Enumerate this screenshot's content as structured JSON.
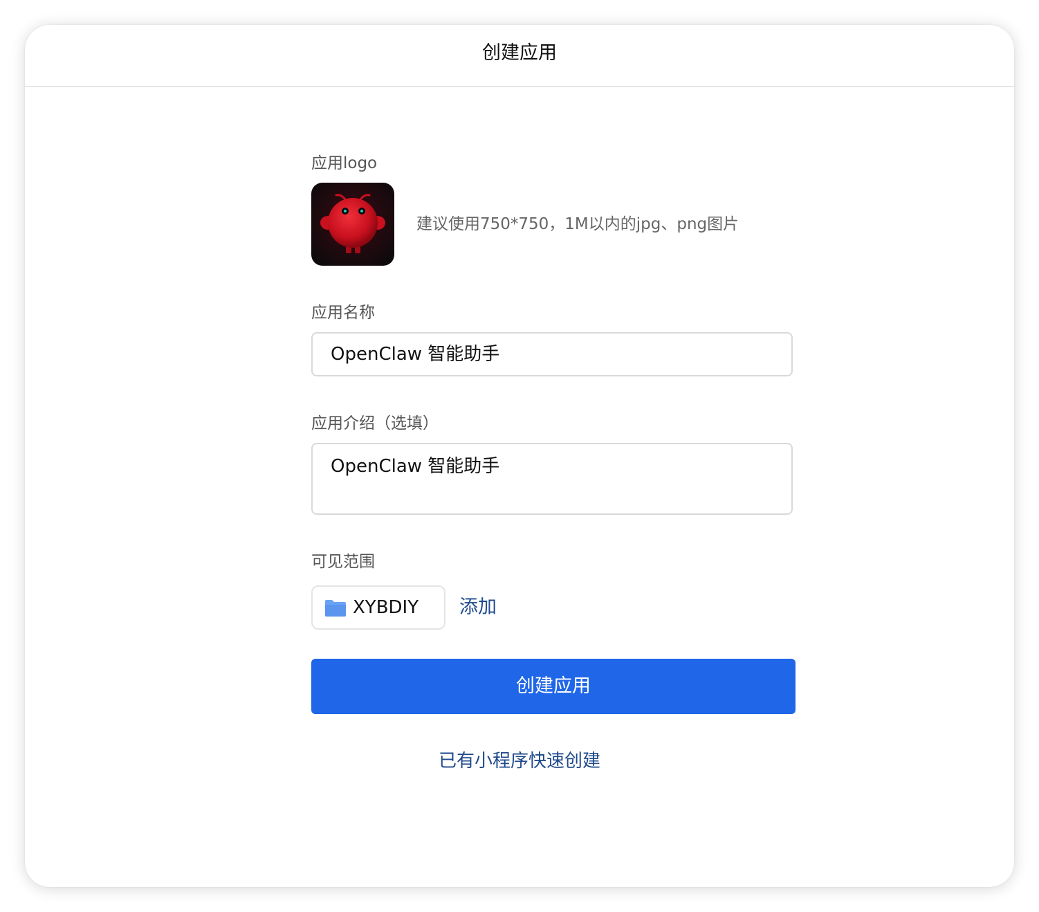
{
  "dialog": {
    "title": "创建应用"
  },
  "logo_field": {
    "label": "应用logo",
    "hint": "建议使用750*750，1M以内的jpg、png图片"
  },
  "name_field": {
    "label": "应用名称",
    "value": "OpenClaw 智能助手"
  },
  "intro_field": {
    "label": "应用介绍（选填）",
    "value": "OpenClaw 智能助手"
  },
  "visibility_field": {
    "label": "可见范围",
    "scope_chip": {
      "icon": "folder-icon",
      "label": "XYBDIY"
    },
    "add_label": "添加"
  },
  "actions": {
    "create_button_label": "创建应用",
    "quick_create_link": "已有小程序快速创建"
  },
  "colors": {
    "primary": "#1f66e8",
    "link": "#1f4a8c",
    "folder_icon": "#6aa2f4"
  }
}
